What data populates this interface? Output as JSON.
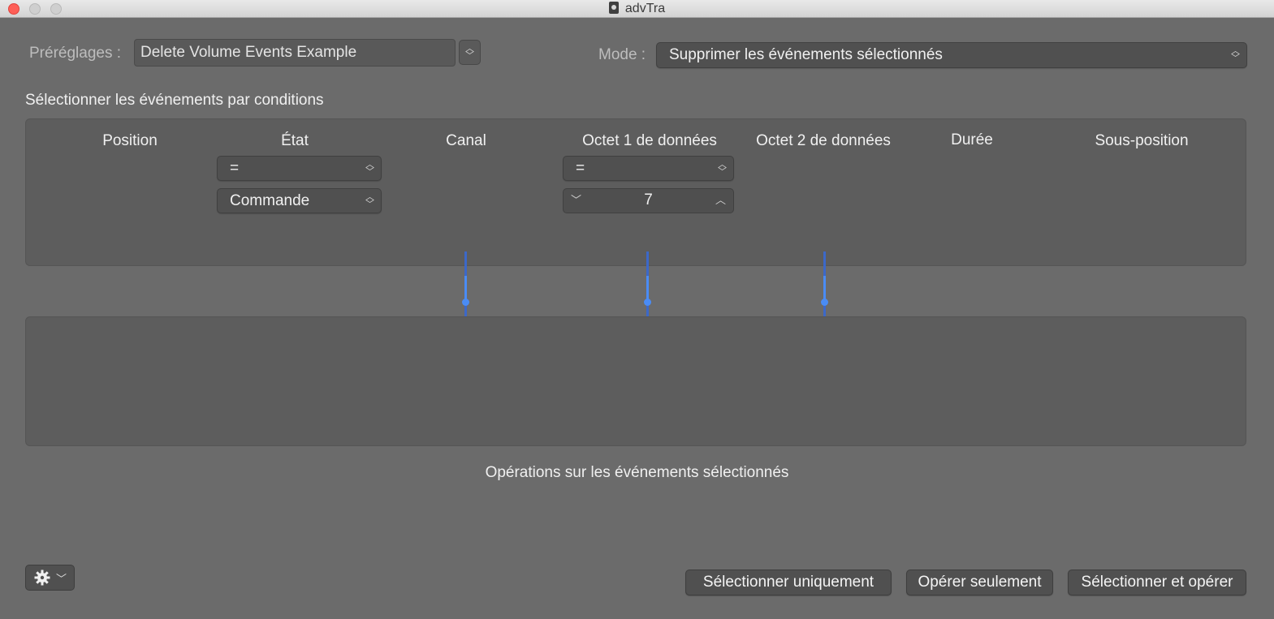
{
  "window": {
    "title": "advTra"
  },
  "presets": {
    "label": "Préréglages :",
    "value": "Delete Volume Events Example"
  },
  "mode": {
    "label": "Mode :",
    "value": "Supprimer les événements sélectionnés"
  },
  "conditions": {
    "title": "Sélectionner les événements par conditions",
    "columns": [
      "Position",
      "État",
      "Canal",
      "Octet 1 de données",
      "Octet 2 de données",
      "Durée",
      "Sous-position"
    ],
    "etat": {
      "operator": "=",
      "value": "Commande"
    },
    "octet1": {
      "operator": "=",
      "value": "7"
    }
  },
  "operations": {
    "title": "Opérations sur les événements sélectionnés"
  },
  "buttons": {
    "select_only": "Sélectionner uniquement",
    "operate_only": "Opérer seulement",
    "select_and_operate": "Sélectionner et opérer"
  },
  "icons": {
    "gear": "gear-icon",
    "chevron": "chevron-down-icon",
    "updown": "up-down-chevron-icon"
  },
  "colors": {
    "connector": "#4a8cf5",
    "close": "#fe5f57"
  }
}
